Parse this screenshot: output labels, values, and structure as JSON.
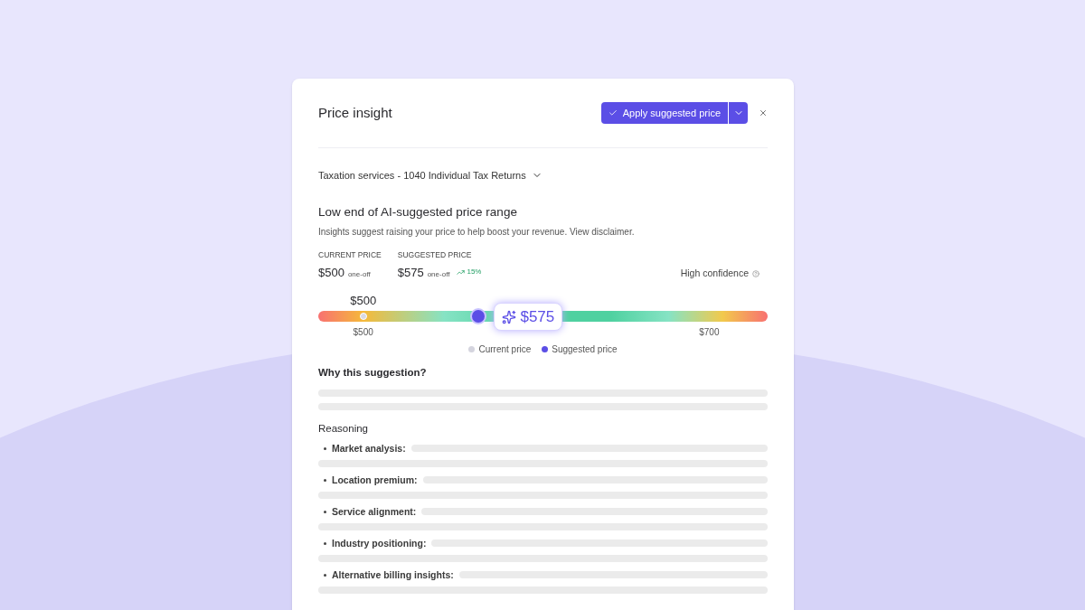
{
  "dialog": {
    "title": "Price insight",
    "apply_button": "Apply suggested price",
    "service_selector": "Taxation services - 1040 Individual Tax Returns"
  },
  "insight": {
    "heading": "Low end of AI-suggested price range",
    "description": "Insights suggest raising your price to help boost your revenue. View disclaimer."
  },
  "prices": [
    {
      "label": "CURRENT PRICE",
      "amount": "$500",
      "term": "one-off"
    },
    {
      "label": "SUGGESTED PRICE",
      "amount": "$575",
      "term": "one-off",
      "change": "15%"
    }
  ],
  "confidence": "High confidence",
  "slider": {
    "current_label": "$500",
    "current_marker": {
      "level": 0.1
    },
    "level": 0.357,
    "bubble": "$575",
    "min_label": "$500",
    "max_label": "$700"
  },
  "legend": [
    {
      "label": "Current price",
      "color": "#d4d4de"
    },
    {
      "label": "Suggested price",
      "color": "#5b4ee6"
    }
  ],
  "why_heading": "Why this suggestion?",
  "reasoning": {
    "heading": "Reasoning",
    "items": [
      "Market analysis:",
      "Location premium:",
      "Service alignment:",
      "Industry positioning:",
      "Alternative billing insights:"
    ]
  }
}
